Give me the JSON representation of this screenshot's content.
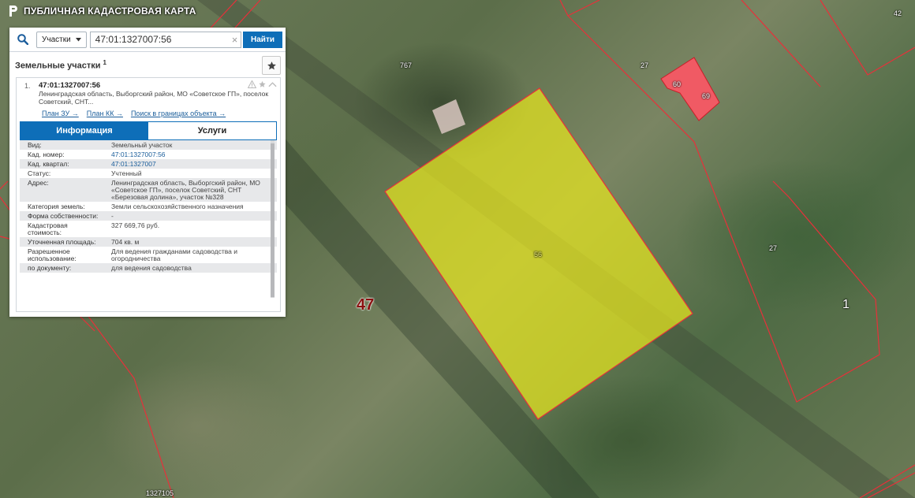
{
  "app": {
    "title": "ПУБЛИЧНАЯ КАДАСТРОВАЯ КАРТА"
  },
  "search": {
    "type_label": "Участки",
    "value": "47:01:1327007:56",
    "button_label": "Найти"
  },
  "results": {
    "title": "Земельные участки",
    "count": "1"
  },
  "item": {
    "index": "1.",
    "cad_number": "47:01:1327007:56",
    "address_short": "Ленинградская область, Выборгский район, МО «Советское ГП», поселок Советский, СНТ...",
    "links": [
      "План ЗУ →",
      "План КК →",
      "Поиск в границах объекта →"
    ]
  },
  "tabs": [
    "Информация",
    "Услуги"
  ],
  "attributes": [
    {
      "key": "Вид:",
      "value": "Земельный участок"
    },
    {
      "key": "Кад. номер:",
      "value": "47:01:1327007:56"
    },
    {
      "key": "Кад. квартал:",
      "value": "47:01:1327007"
    },
    {
      "key": "Статус:",
      "value": "Учтенный"
    },
    {
      "key": "Адрес:",
      "value": "Ленинградская область, Выборгский район, МО «Советское ГП», поселок Советский, СНТ «Березовая долина», участок №328"
    },
    {
      "key": "Категория земель:",
      "value": "Земли сельскохозяйственного назначения"
    },
    {
      "key": "Форма собственности:",
      "value": "-"
    },
    {
      "key": "Кадастровая стоимость:",
      "value": "327 669,76 руб."
    },
    {
      "key": "Уточненная площадь:",
      "value": "704 кв. м"
    },
    {
      "key": "Разрешенное использование:",
      "value": "Для ведения гражданами садоводства и огородничества"
    },
    {
      "key": "по документу:",
      "value": "для ведения садоводства"
    }
  ],
  "map_labels": {
    "l767": "767",
    "l27a": "27",
    "l60": "60",
    "l69": "69",
    "l42": "42",
    "l11": "11",
    "l56": "56",
    "l27b": "27",
    "l47": "47",
    "l1": "1",
    "lq": "1327105"
  },
  "colors": {
    "parcel_selected_fill": "#e6e61e",
    "parcel_border": "#e8303a",
    "building_fill": "#f05a64",
    "accent": "#0e6eb8"
  }
}
